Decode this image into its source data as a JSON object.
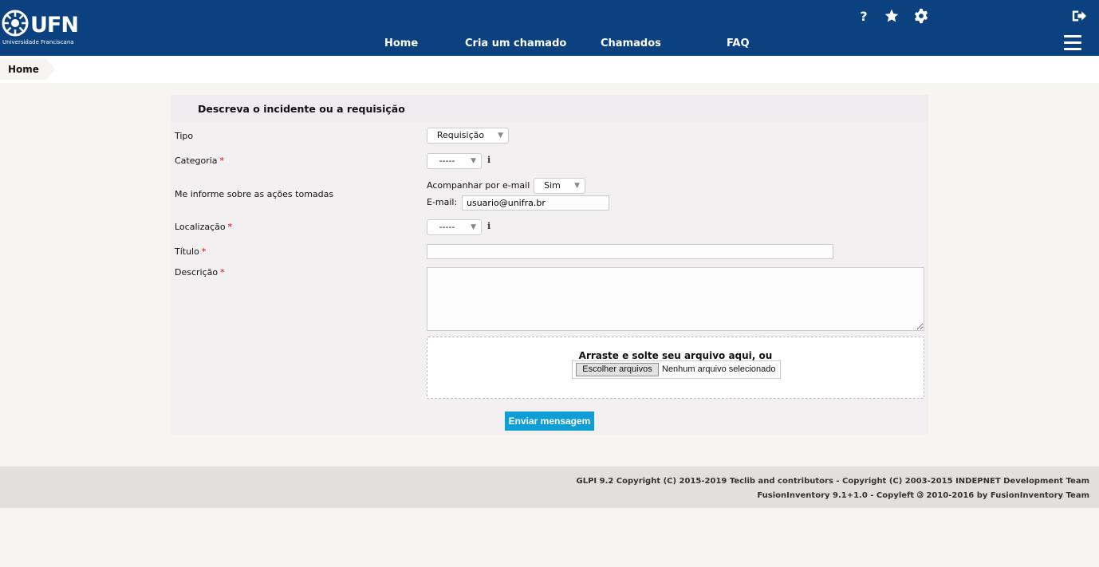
{
  "header": {
    "logo_text": "UFN",
    "logo_subtitle": "Universidade Franciscana",
    "nav": [
      "Home",
      "Cria um chamado",
      "Chamados",
      "FAQ"
    ],
    "icons": {
      "help": "?",
      "favorites": "star-icon",
      "preferences": "gear-icon",
      "logout": "logout-icon",
      "menu": "hamburger-icon"
    },
    "colors": {
      "background": "#0b417f",
      "text": "#ffffff"
    }
  },
  "breadcrumb": {
    "home": "Home"
  },
  "form": {
    "title": "Descreva o incidente ou a requisição",
    "tipo": {
      "label": "Tipo",
      "value": "Requisição"
    },
    "categoria": {
      "label": "Categoria",
      "required": "*",
      "value": "-----",
      "info": "i"
    },
    "notify": {
      "label": "Me informe sobre as ações tomadas",
      "follow_label": "Acompanhar por e-mail",
      "follow_value": "Sim",
      "email_label": "E-mail:",
      "email_value": "usuario@unifra.br"
    },
    "localizacao": {
      "label": "Localização",
      "required": "*",
      "value": "-----",
      "info": "i"
    },
    "titulo": {
      "label": "Título",
      "required": "*",
      "value": ""
    },
    "descricao": {
      "label": "Descrição",
      "required": "*",
      "value": ""
    },
    "upload": {
      "drop_text": "Arraste e solte seu arquivo aqui, ou",
      "button": "Escolher arquivos",
      "status": "Nenhum arquivo selecionado"
    },
    "submit": "Enviar mensagem",
    "colors": {
      "required": "#dd0000",
      "submit": "#0f9dd6"
    }
  },
  "footer": {
    "line1": "GLPI 9.2 Copyright (C) 2015-2019 Teclib and contributors - Copyright (C) 2003-2015 INDEPNET Development Team",
    "line2": "FusionInventory 9.1+1.0 - Copyleft 🄯 2010-2016 by FusionInventory Team"
  }
}
